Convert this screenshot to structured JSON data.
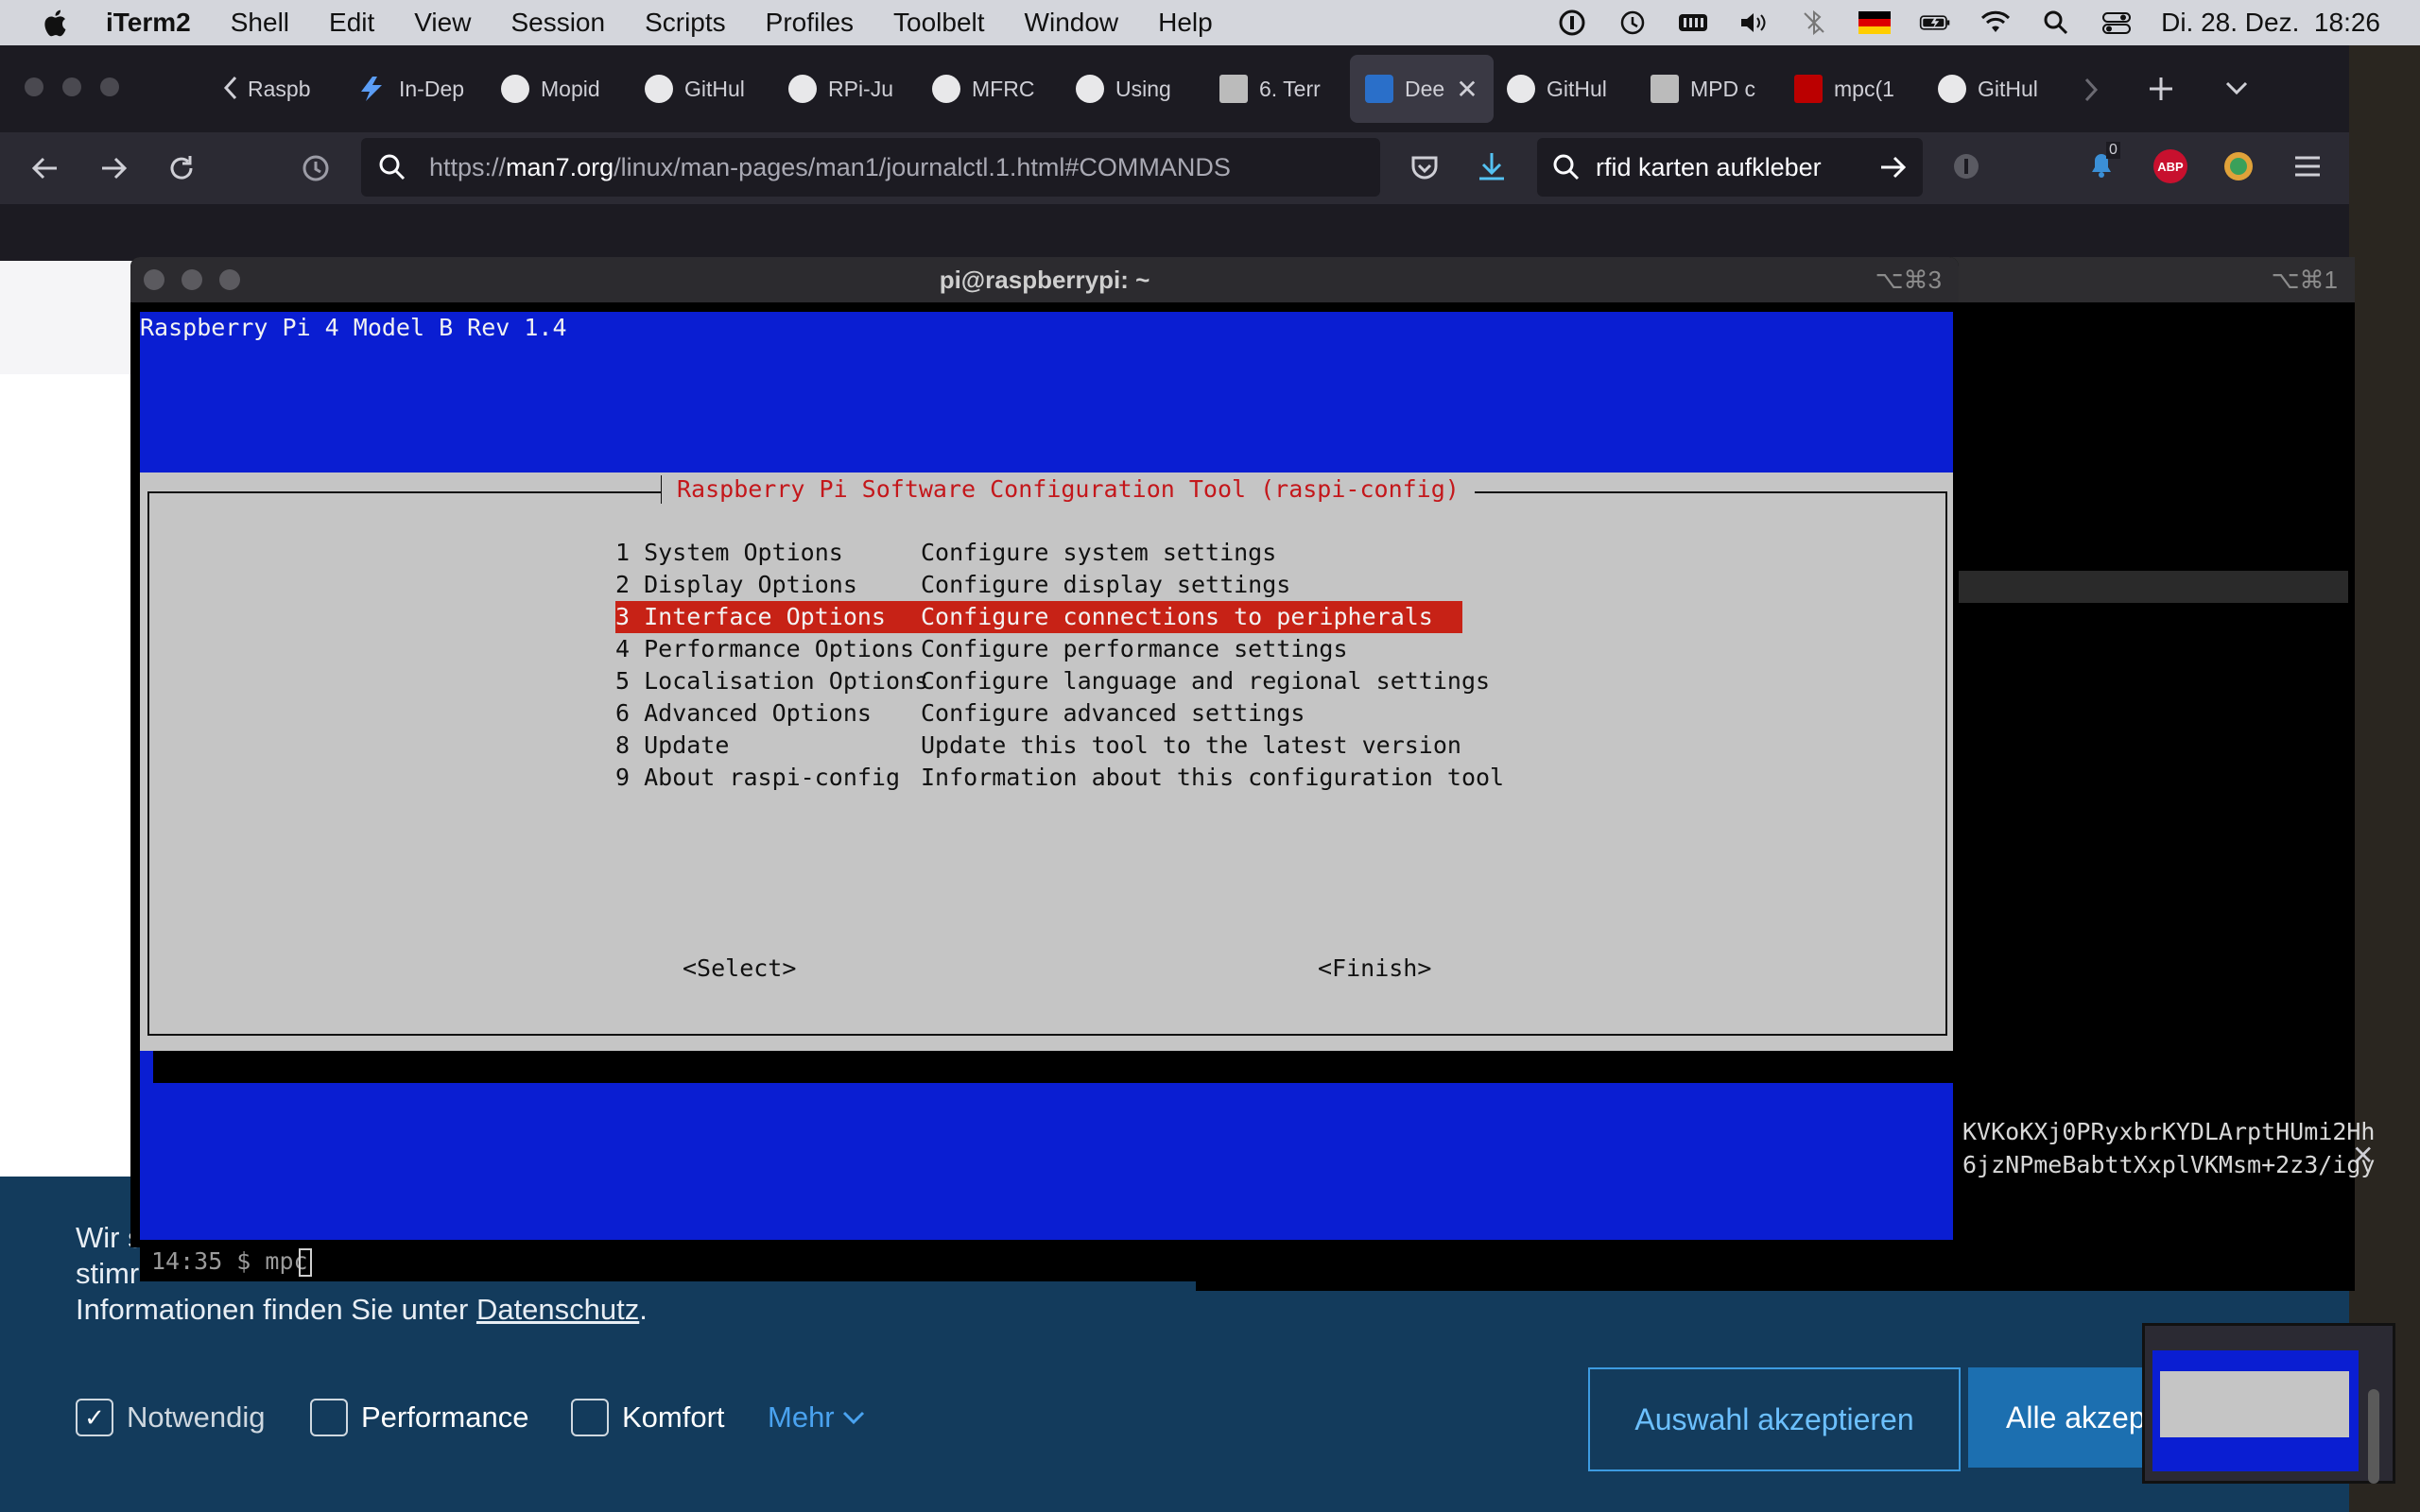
{
  "menubar": {
    "app": "iTerm2",
    "items": [
      "Shell",
      "Edit",
      "View",
      "Session",
      "Scripts",
      "Profiles",
      "Toolbelt",
      "Window",
      "Help"
    ],
    "clock": "Di. 28. Dez.  18:26"
  },
  "browser": {
    "tabs": [
      {
        "label": "Raspb"
      },
      {
        "label": "In-Dep"
      },
      {
        "label": "Mopid"
      },
      {
        "label": "GitHul"
      },
      {
        "label": "RPi-Ju"
      },
      {
        "label": "MFRC"
      },
      {
        "label": "Using"
      },
      {
        "label": "6. Terr"
      },
      {
        "label": "Dee",
        "active": true
      },
      {
        "label": "GitHul"
      },
      {
        "label": "MPD c"
      },
      {
        "label": "mpc(1"
      },
      {
        "label": "GitHul"
      }
    ],
    "url_prefix": "https://",
    "url_host": "man7.org",
    "url_path": "/linux/man-pages/man1/journalctl.1.html#COMMANDS",
    "search_value": "rfid karten aufkleber",
    "notif_count": "0",
    "abp": "ABP"
  },
  "cookie": {
    "line1": "Wir s",
    "line2": "stimr",
    "line3_prefix": "Informationen finden Sie unter ",
    "line3_link": "Datenschutz",
    "line3_suffix": ".",
    "options": [
      {
        "label": "Notwendig",
        "checked": true
      },
      {
        "label": "Performance",
        "checked": false
      },
      {
        "label": "Komfort",
        "checked": false
      }
    ],
    "more": "Mehr",
    "accept_selection": "Auswahl akzeptieren",
    "accept_all": "Alle akzep"
  },
  "terminal_back": {
    "shortcut": "⌥⌘1",
    "line1": "KVKoKXj0PRyxbrKYDLArptHUmi2Hh",
    "line2": "6jzNPmeBabttXxplVKMsm+2z3/igy"
  },
  "terminal": {
    "title": "pi@raspberrypi: ~",
    "shortcut": "⌥⌘3",
    "header": "Raspberry Pi 4 Model B Rev 1.4",
    "dialog_title": "Raspberry Pi Software Configuration Tool (raspi-config)",
    "menu": [
      {
        "key": "1 System Options",
        "desc": "Configure system settings"
      },
      {
        "key": "2 Display Options",
        "desc": "Configure display settings"
      },
      {
        "key": "3 Interface Options",
        "desc": "Configure connections to peripherals",
        "selected": true
      },
      {
        "key": "4 Performance Options",
        "desc": "Configure performance settings"
      },
      {
        "key": "5 Localisation Options",
        "desc": "Configure language and regional settings"
      },
      {
        "key": "6 Advanced Options",
        "desc": "Configure advanced settings"
      },
      {
        "key": "8 Update",
        "desc": "Update this tool to the latest version"
      },
      {
        "key": "9 About raspi-config",
        "desc": "Information about this configuration tool"
      }
    ],
    "select_btn": "<Select>",
    "finish_btn": "<Finish>",
    "prompt": "14:35 $ mpc"
  },
  "colors": {
    "terminal_blue": "#0a1ed2",
    "dialog_gray": "#c5c5c5",
    "selection_red": "#c72216",
    "cookie_blue": "#133b5c"
  }
}
